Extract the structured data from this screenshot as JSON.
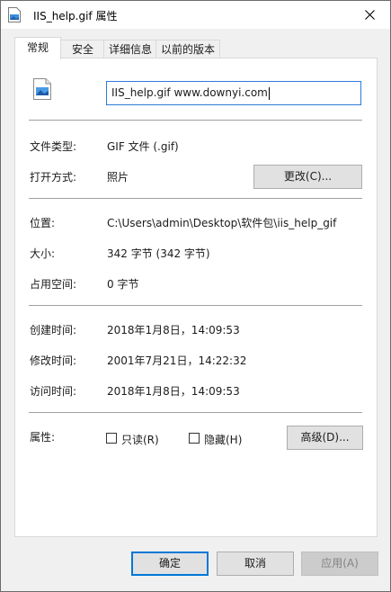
{
  "window": {
    "title": "IIS_help.gif 属性"
  },
  "tabs": [
    {
      "label": "常规",
      "active": true
    },
    {
      "label": "安全",
      "active": false
    },
    {
      "label": "详细信息",
      "active": false
    },
    {
      "label": "以前的版本",
      "active": false
    }
  ],
  "general": {
    "file_name": "IIS_help.gif www.downyi.com",
    "file_type_label": "文件类型:",
    "file_type_value": "GIF 文件 (.gif)",
    "open_with_label": "打开方式:",
    "open_with_value": "照片",
    "change_button": "更改(C)...",
    "location_label": "位置:",
    "location_value": "C:\\Users\\admin\\Desktop\\软件包\\iis_help_gif",
    "size_label": "大小:",
    "size_value": "342 字节 (342 字节)",
    "size_on_disk_label": "占用空间:",
    "size_on_disk_value": "0 字节",
    "created_label": "创建时间:",
    "created_value": "2018年1月8日，14:09:53",
    "modified_label": "修改时间:",
    "modified_value": "2001年7月21日，14:22:32",
    "accessed_label": "访问时间:",
    "accessed_value": "2018年1月8日，14:09:53",
    "attributes_label": "属性:",
    "readonly_label": "只读(R)",
    "readonly_checked": false,
    "hidden_label": "隐藏(H)",
    "hidden_checked": false,
    "advanced_button": "高级(D)..."
  },
  "footer": {
    "ok_button": "确定",
    "cancel_button": "取消",
    "apply_button": "应用(A)"
  },
  "colors": {
    "accent": "#0078d7",
    "focus_border": "#2d7ad6",
    "background": "#f0f0f0"
  }
}
